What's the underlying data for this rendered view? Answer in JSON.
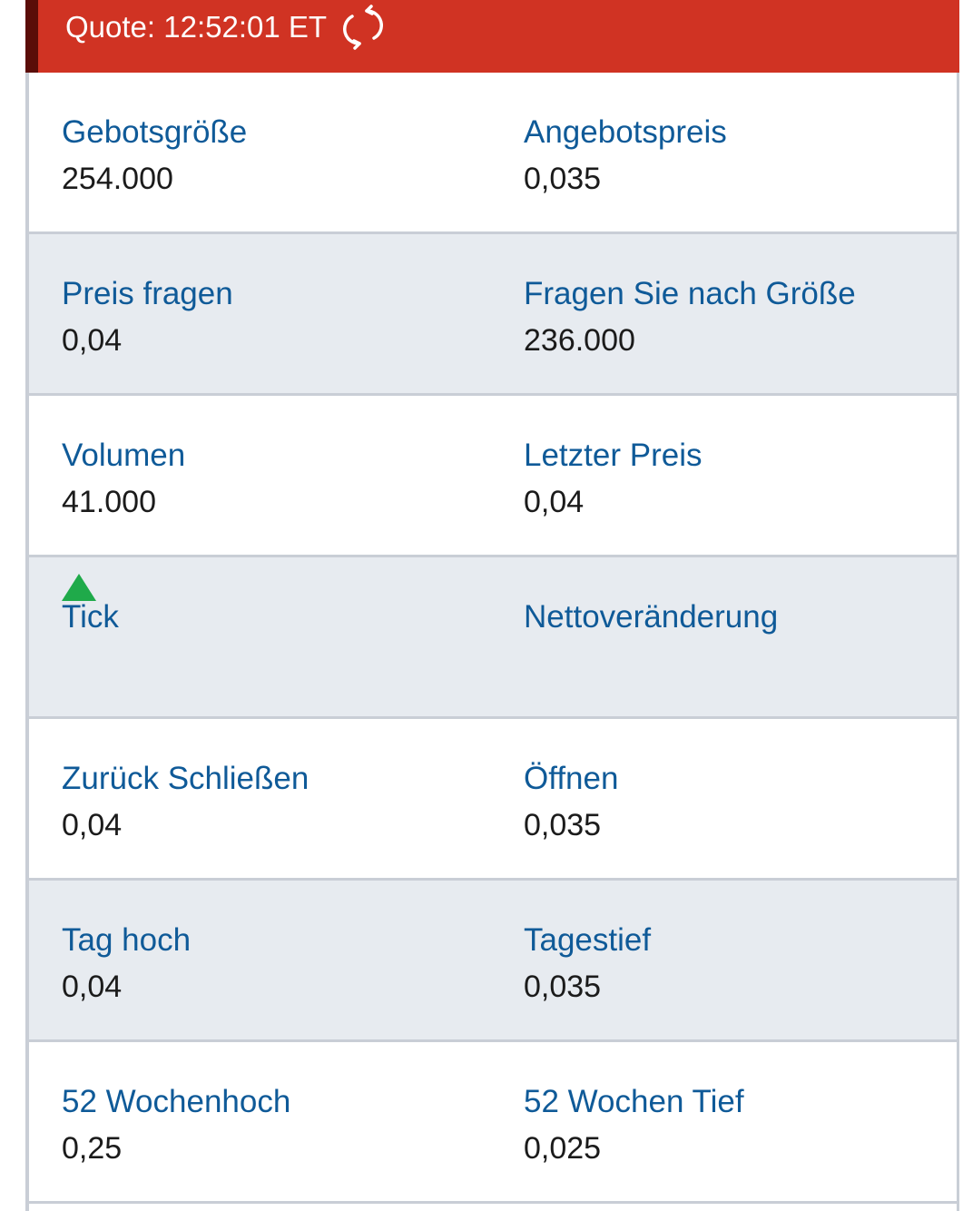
{
  "header": {
    "quote_text": "Quote: 12:52:01 ET",
    "refresh_icon": "refresh-icon",
    "background_color": "#d03323"
  },
  "colors": {
    "label": "#0f5a98",
    "value": "#1b1b1b",
    "row_shaded": "#e7ebf0",
    "tick_up": "#1faa4a"
  },
  "rows": [
    {
      "left": {
        "label": "Gebotsgröße",
        "value": "254.000"
      },
      "right": {
        "label": "Angebotspreis",
        "value": "0,035"
      }
    },
    {
      "left": {
        "label": "Preis fragen",
        "value": "0,04"
      },
      "right": {
        "label": "Fragen Sie nach Größe",
        "value": "236.000"
      }
    },
    {
      "left": {
        "label": "Volumen",
        "value": "41.000"
      },
      "right": {
        "label": "Letzter Preis",
        "value": "0,04"
      }
    },
    {
      "left": {
        "label": "Tick",
        "value_icon": "triangle-up-icon"
      },
      "right": {
        "label": "Nettoveränderung",
        "value": ""
      }
    },
    {
      "left": {
        "label": "Zurück Schließen",
        "value": "0,04"
      },
      "right": {
        "label": "Öffnen",
        "value": "0,035"
      }
    },
    {
      "left": {
        "label": "Tag hoch",
        "value": "0,04"
      },
      "right": {
        "label": "Tagestief",
        "value": "0,035"
      }
    },
    {
      "left": {
        "label": "52 Wochenhoch",
        "value": "0,25"
      },
      "right": {
        "label": "52 Wochen Tief",
        "value": "0,025"
      }
    }
  ]
}
